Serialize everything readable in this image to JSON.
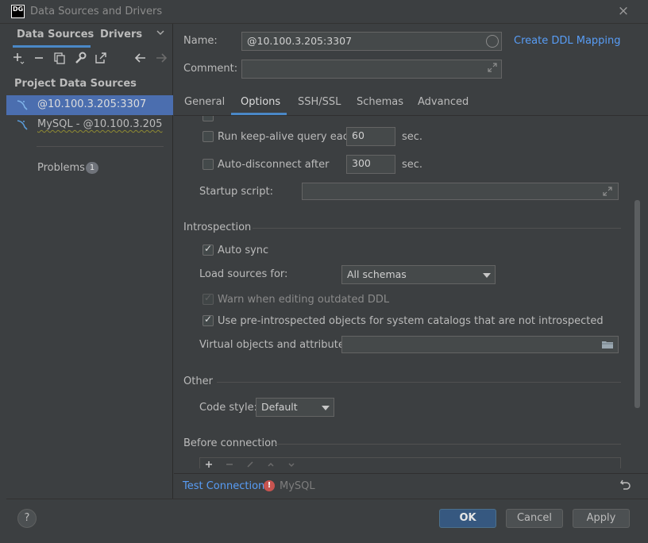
{
  "window": {
    "app_logo": "DG",
    "title": "Data Sources and Drivers",
    "close_icon": "×"
  },
  "sidebar": {
    "tabs": [
      "Data Sources",
      "Drivers"
    ],
    "toolbar_icons": [
      "add-icon",
      "remove-icon",
      "duplicate-icon",
      "wrench-icon",
      "export-icon",
      "back-icon",
      "forward-icon"
    ],
    "section_title": "Project Data Sources",
    "items": [
      {
        "label": "@10.100.3.205:3307",
        "selected": true
      },
      {
        "label": "MySQL - @10.100.3.205",
        "selected": false
      }
    ],
    "problems_label": "Problems",
    "problems_count": "1"
  },
  "form": {
    "name_label": "Name:",
    "name_value": "@10.100.3.205:3307",
    "ddl_link": "Create DDL Mapping",
    "comment_label": "Comment:",
    "comment_value": ""
  },
  "tabs": [
    "General",
    "Options",
    "SSH/SSL",
    "Schemas",
    "Advanced"
  ],
  "active_tab": "Options",
  "options": {
    "keepalive_label": "Run keep-alive query each",
    "keepalive_value": "60",
    "keepalive_unit": "sec.",
    "autodisconnect_label": "Auto-disconnect after",
    "autodisconnect_value": "300",
    "autodisconnect_unit": "sec.",
    "startup_label": "Startup script:",
    "startup_value": ""
  },
  "introspection": {
    "title": "Introspection",
    "auto_sync_label": "Auto sync",
    "load_sources_label": "Load sources for:",
    "load_sources_value": "All schemas",
    "warn_ddl_label": "Warn when editing outdated DDL",
    "preintro_label": "Use pre-introspected objects for system catalogs that are not introspected",
    "virtual_label": "Virtual objects and attributes:",
    "virtual_value": ""
  },
  "other": {
    "title": "Other",
    "code_style_label": "Code style:",
    "code_style_value": "Default"
  },
  "before_connection": {
    "title": "Before connection"
  },
  "status": {
    "test_connection": "Test Connection",
    "warning_mark": "!",
    "driver": "MySQL"
  },
  "footer": {
    "help": "?",
    "ok": "OK",
    "cancel": "Cancel",
    "apply": "Apply"
  },
  "colors": {
    "accent": "#4a88c7",
    "link": "#589df6",
    "selection": "#4b6eaf",
    "error": "#c75450"
  }
}
